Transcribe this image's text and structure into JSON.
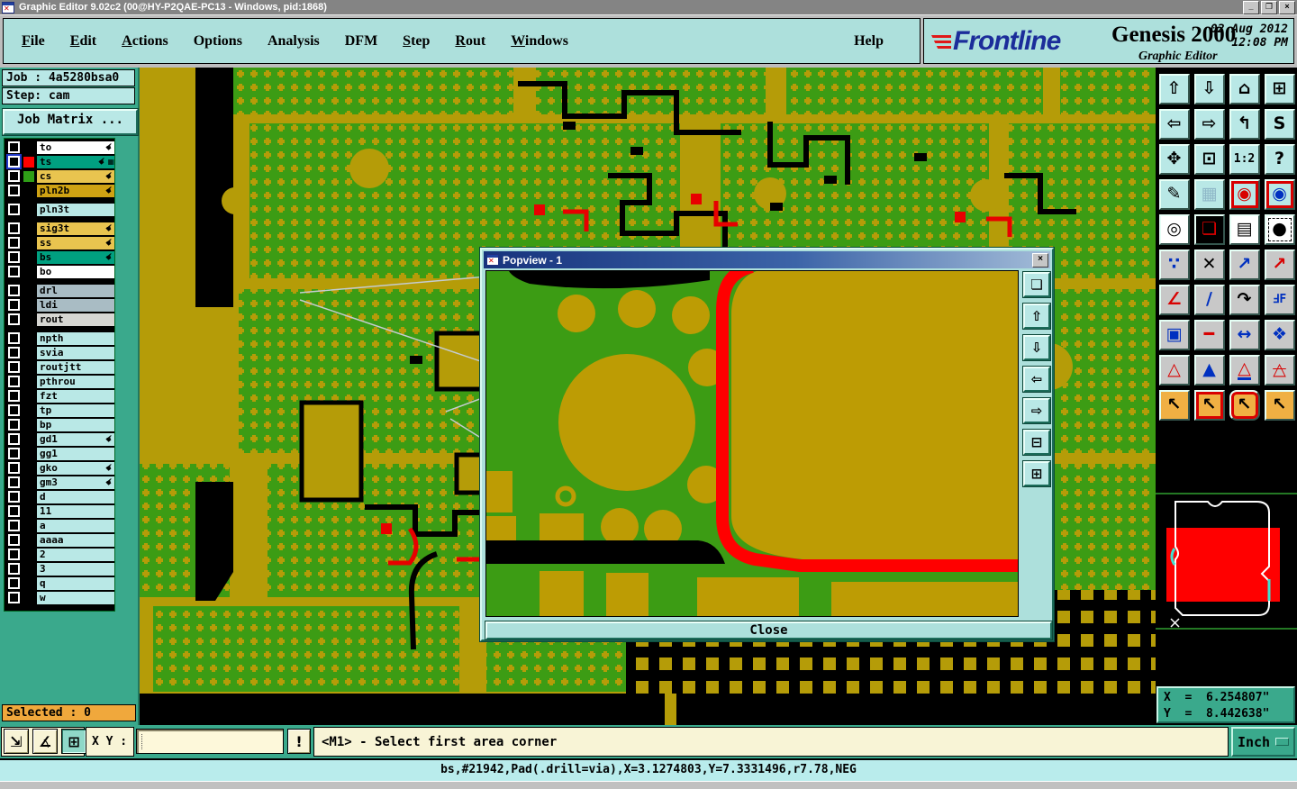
{
  "window": {
    "title": "Graphic Editor 9.02c2 (00@HY-P2QAE-PC13 - Windows, pid:1868)",
    "controls": [
      {
        "name": "minimize",
        "glyph": "_"
      },
      {
        "name": "restore",
        "glyph": "❐"
      },
      {
        "name": "close",
        "glyph": "×"
      }
    ]
  },
  "menu": {
    "items": [
      {
        "label": "File",
        "u": 0
      },
      {
        "label": "Edit",
        "u": 0
      },
      {
        "label": "Actions",
        "u": 0
      },
      {
        "label": "Options",
        "u": -1
      },
      {
        "label": "Analysis",
        "u": -1
      },
      {
        "label": "DFM",
        "u": -1
      },
      {
        "label": "Step",
        "u": 0
      },
      {
        "label": "Rout",
        "u": 0
      },
      {
        "label": "Windows",
        "u": 0
      }
    ],
    "help": "Help"
  },
  "brand": {
    "logo": "Frontline",
    "product": "Genesis 2000",
    "date": "02 Aug 2012",
    "time": "12:08 PM",
    "subtitle": "Graphic Editor",
    "logo_color": "#1b2d9a",
    "speed_lines_color": "#e01818"
  },
  "sidebar": {
    "job_label": "Job : 4a5280bsa0",
    "step_label": "Step: cam",
    "job_matrix_label": "Job Matrix ...",
    "selected_label": "Selected : 0",
    "selected_bg": "#f0a83c",
    "layers": [
      {
        "name": "to",
        "bg": "#ffffff",
        "swatch": "#000000",
        "hand": true
      },
      {
        "name": "ts",
        "bg": "#00a080",
        "swatch": "#ff0000",
        "hand": true,
        "grid": true,
        "checkbox": "blue"
      },
      {
        "name": "cs",
        "bg": "#e9c44f",
        "swatch": "#2f9e17",
        "hand": true
      },
      {
        "name": "pln2b",
        "bg": "#cfa213",
        "swatch": "#000000",
        "hand": true
      },
      {
        "name": "pln3t",
        "bg": "#b9e8e6",
        "gap": true
      },
      {
        "name": "sig3t",
        "bg": "#e9c44f",
        "hand": true,
        "gap": true
      },
      {
        "name": "ss",
        "bg": "#e9c44f",
        "hand": true
      },
      {
        "name": "bs",
        "bg": "#00a080",
        "hand": true
      },
      {
        "name": "bo",
        "bg": "#ffffff"
      },
      {
        "name": "drl",
        "bg": "#a9bcc4",
        "gap": true
      },
      {
        "name": "ldi",
        "bg": "#a9bcc4"
      },
      {
        "name": "rout",
        "bg": "#d6d6d2"
      },
      {
        "name": "npth",
        "bg": "#b9e8e6",
        "gap": true
      },
      {
        "name": "svia",
        "bg": "#b9e8e6"
      },
      {
        "name": "routjtt",
        "bg": "#b9e8e6"
      },
      {
        "name": "pthrou",
        "bg": "#b9e8e6"
      },
      {
        "name": "fzt",
        "bg": "#b9e8e6"
      },
      {
        "name": "tp",
        "bg": "#b9e8e6"
      },
      {
        "name": "bp",
        "bg": "#b9e8e6"
      },
      {
        "name": "gd1",
        "bg": "#b9e8e6",
        "hand": true
      },
      {
        "name": "gg1",
        "bg": "#b9e8e6"
      },
      {
        "name": "gko",
        "bg": "#b9e8e6",
        "hand": true
      },
      {
        "name": "gm3",
        "bg": "#b9e8e6",
        "hand": true
      },
      {
        "name": "d",
        "bg": "#b9e8e6"
      },
      {
        "name": "11",
        "bg": "#b9e8e6"
      },
      {
        "name": "a",
        "bg": "#b9e8e6"
      },
      {
        "name": "aaaa",
        "bg": "#b9e8e6"
      },
      {
        "name": "2",
        "bg": "#b9e8e6"
      },
      {
        "name": "3",
        "bg": "#b9e8e6"
      },
      {
        "name": "q",
        "bg": "#b9e8e6"
      },
      {
        "name": "w",
        "bg": "#b9e8e6"
      }
    ]
  },
  "right_toolbar": {
    "buttons": [
      {
        "name": "view-zoom-in",
        "icon": "zoom-in-window-icon",
        "glyph": "⇧"
      },
      {
        "name": "view-zoom-out",
        "icon": "zoom-out-window-icon",
        "glyph": "⇩"
      },
      {
        "name": "view-home",
        "icon": "home-icon",
        "glyph": "⌂"
      },
      {
        "name": "view-windows-xy",
        "icon": "split-window-icon",
        "glyph": "⊞"
      },
      {
        "name": "view-pan-left",
        "icon": "pan-left-icon",
        "glyph": "⇦"
      },
      {
        "name": "view-pan-right",
        "icon": "pan-right-icon",
        "glyph": "⇨"
      },
      {
        "name": "view-previous",
        "icon": "previous-view-icon",
        "glyph": "↰"
      },
      {
        "name": "view-redraw",
        "icon": "redraw-icon",
        "glyph": "S"
      },
      {
        "name": "view-expand",
        "icon": "expand-view-icon",
        "glyph": "✥"
      },
      {
        "name": "view-fit",
        "icon": "fit-view-icon",
        "glyph": "⊡"
      },
      {
        "name": "view-zoom-1-2",
        "icon": "zoom-ratio-icon",
        "glyph": "1:2",
        "small": true
      },
      {
        "name": "view-query",
        "icon": "query-icon",
        "glyph": "?"
      },
      {
        "name": "setup-tools",
        "icon": "tools-pencil-icon",
        "glyph": "✎"
      },
      {
        "name": "grid-toggle",
        "icon": "grid-icon",
        "glyph": "▦",
        "fg": "#8fb8c8"
      },
      {
        "name": "net-view-1",
        "icon": "net-red-icon",
        "glyph": "◉",
        "fg": "#d80000",
        "frame": "red"
      },
      {
        "name": "net-view-2",
        "icon": "net-blue-icon",
        "glyph": "◉",
        "fg": "#0030c0",
        "frame": "red"
      },
      {
        "name": "select-single",
        "icon": "select-circle-icon",
        "glyph": "◎",
        "bg": "#ffffff"
      },
      {
        "name": "layers-copy",
        "icon": "copy-layers-icon",
        "glyph": "❏",
        "bg": "#000000",
        "fg": "#e00000"
      },
      {
        "name": "measure-ruler",
        "icon": "ruler-icon",
        "glyph": "▤",
        "bg": "#ffffff"
      },
      {
        "name": "select-reference",
        "icon": "dashed-select-icon",
        "glyph": "●",
        "bg": "#ffffff",
        "frame": "dashed"
      },
      {
        "name": "select-chain",
        "icon": "chain-dots-icon",
        "glyph": "∵",
        "bg": "#c8c8c8",
        "fg": "#0030c0"
      },
      {
        "name": "delete-feature",
        "icon": "delete-x-icon",
        "glyph": "✕",
        "bg": "#c8c8c8"
      },
      {
        "name": "copy-feature",
        "icon": "copy-arrow-icon",
        "glyph": "↗",
        "bg": "#c8c8c8",
        "fg": "#0030c0"
      },
      {
        "name": "move-feature",
        "icon": "move-arrow-icon",
        "glyph": "↗",
        "bg": "#c8c8c8",
        "fg": "#d80000"
      },
      {
        "name": "measure-angle",
        "icon": "angle-icon",
        "glyph": "∠",
        "bg": "#c8c8c8",
        "fg": "#d80000"
      },
      {
        "name": "measure-slope",
        "icon": "slope-line-icon",
        "glyph": "∕",
        "bg": "#c8c8c8",
        "fg": "#0030c0"
      },
      {
        "name": "rotate-feature",
        "icon": "rotate-arrow-icon",
        "glyph": "↷",
        "bg": "#c8c8c8"
      },
      {
        "name": "mirror-feature",
        "icon": "mirror-ff-icon",
        "glyph": "ℲF",
        "bg": "#c8c8c8",
        "fg": "#0030c0",
        "small": true
      },
      {
        "name": "copy-other-layer",
        "icon": "copy-pad-icon",
        "glyph": "▣",
        "bg": "#c8c8c8",
        "fg": "#0030c0"
      },
      {
        "name": "stretch-line",
        "icon": "stretch-line-icon",
        "glyph": "━",
        "bg": "#c8c8c8",
        "fg": "#d80000"
      },
      {
        "name": "measure-distance",
        "icon": "distance-arrows-icon",
        "glyph": "↔",
        "bg": "#c8c8c8",
        "fg": "#0030c0"
      },
      {
        "name": "join-shapes",
        "icon": "shapes-icon",
        "glyph": "❖",
        "bg": "#c8c8c8",
        "fg": "#0030c0"
      },
      {
        "name": "filter-mode-1",
        "icon": "triangle-filter-icon",
        "glyph": "△",
        "bg": "#c8c8c8",
        "fg": "#d80000"
      },
      {
        "name": "filter-mode-2",
        "icon": "triangle-filter-icon",
        "glyph": "▲",
        "bg": "#c8c8c8",
        "fg": "#0030c0"
      },
      {
        "name": "filter-mode-3",
        "icon": "triangle-filter-icon",
        "glyph": "△",
        "bg": "#c8c8c8",
        "fg": "#d80000",
        "deco": "u-blue"
      },
      {
        "name": "filter-mode-4",
        "icon": "triangle-filter-icon",
        "glyph": "△",
        "bg": "#c8c8c8",
        "fg": "#d80000",
        "deco": "strike"
      },
      {
        "name": "select-mode-point",
        "icon": "cursor-icon",
        "glyph": "↖",
        "bg": "#f0b043"
      },
      {
        "name": "select-mode-frame",
        "icon": "cursor-frame-icon",
        "glyph": "↖",
        "bg": "#f0b043",
        "frame": "red"
      },
      {
        "name": "select-mode-inside",
        "icon": "cursor-lasso-icon",
        "glyph": "↖",
        "bg": "#f0b043",
        "frame": "red-round"
      },
      {
        "name": "select-mode-net",
        "icon": "cursor-net-icon",
        "glyph": "↖",
        "bg": "#f0b043"
      }
    ]
  },
  "popup": {
    "title": "Popview - 1",
    "close_label": "Close",
    "close_icon": "×",
    "side_buttons": [
      {
        "name": "popview-new-window",
        "icon": "window-copy-icon",
        "glyph": "❏"
      },
      {
        "name": "popview-zoom-in",
        "icon": "zoom-in-icon",
        "glyph": "⇧"
      },
      {
        "name": "popview-zoom-out",
        "icon": "zoom-out-icon",
        "glyph": "⇩"
      },
      {
        "name": "popview-pan-left",
        "icon": "pan-left-icon",
        "glyph": "⇦"
      },
      {
        "name": "popview-pan-right",
        "icon": "pan-right-icon",
        "glyph": "⇨"
      },
      {
        "name": "popview-shrink",
        "icon": "shrink-icon",
        "glyph": "⊟"
      },
      {
        "name": "popview-expand",
        "icon": "expand-icon",
        "glyph": "⊞"
      }
    ]
  },
  "coords": {
    "x_label": "X  =  6.254807\"",
    "y_label": "Y  =  8.442638\""
  },
  "bottom": {
    "tools": [
      {
        "name": "measure-distance-tool",
        "icon": "diagonal-arrow-icon",
        "glyph": "⇲"
      },
      {
        "name": "measure-angle-tool",
        "icon": "angle-alpha-icon",
        "glyph": "∡"
      },
      {
        "name": "grid-snap-tool",
        "icon": "grid-window-icon",
        "glyph": "⊞",
        "pressed": true
      }
    ],
    "xy_label": "X Y :",
    "input_value": "",
    "alert_label": "!",
    "prompt": "<M1> - Select first area corner",
    "units_label": "Inch"
  },
  "status": {
    "text": "bs,#21942,Pad(.drill=via),X=3.1274803,Y=7.3331496,r7.78,NEG"
  },
  "colors": {
    "frame_teal": "#3aa98c",
    "panel_cyan": "#ade0dc",
    "field_cyan": "#b9e8e6",
    "cream": "#f8f4d6",
    "pcb_green": "#3c9c14",
    "pcb_olive": "#b59c08",
    "pcb_red": "#ff0000",
    "selected_orange": "#f0a83c"
  }
}
